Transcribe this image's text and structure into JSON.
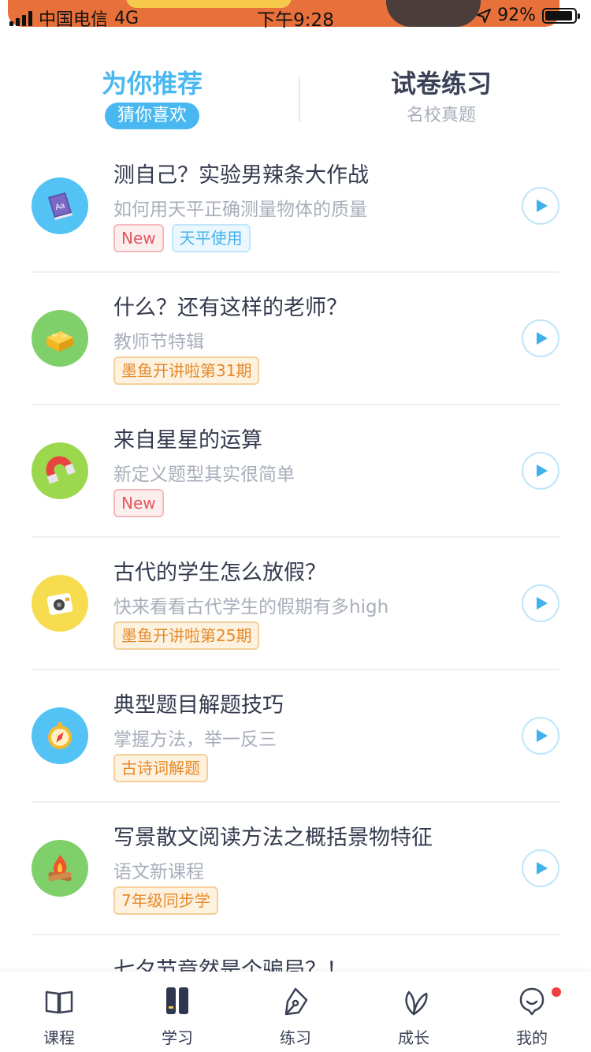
{
  "status_bar": {
    "carrier": "中国电信",
    "network": "4G",
    "time": "下午9:28",
    "battery": "92%"
  },
  "tabs": [
    {
      "title": "为你推荐",
      "subtitle": "猜你喜欢"
    },
    {
      "title": "试卷练习",
      "subtitle": "名校真题"
    }
  ],
  "items": [
    {
      "title": "测自己？实验男辣条大作战",
      "subtitle": "如何用天平正确测量物体的质量",
      "icon": "book-icon",
      "tags": [
        "New",
        "天平使用"
      ]
    },
    {
      "title": "什么？还有这样的老师？",
      "subtitle": "教师节特辑",
      "icon": "block-icon",
      "tags": [
        "墨鱼开讲啦第31期"
      ]
    },
    {
      "title": "来自星星的运算",
      "subtitle": "新定义题型其实很简单",
      "icon": "magnet-icon",
      "tags": [
        "New"
      ]
    },
    {
      "title": "古代的学生怎么放假？",
      "subtitle": "快来看看古代学生的假期有多high",
      "icon": "camera-icon",
      "tags": [
        "墨鱼开讲啦第25期"
      ]
    },
    {
      "title": "典型题目解题技巧",
      "subtitle": "掌握方法，举一反三",
      "icon": "compass-icon",
      "tags": [
        "古诗词解题"
      ]
    },
    {
      "title": "写景散文阅读方法之概括景物特征",
      "subtitle": "语文新课程",
      "icon": "campfire-icon",
      "tags": [
        "7年级同步学"
      ]
    },
    {
      "title": "七夕节竟然是个骗局？！"
    }
  ],
  "nav": [
    {
      "label": "课程",
      "icon": "open-book-icon"
    },
    {
      "label": "学习",
      "icon": "study-books-icon"
    },
    {
      "label": "练习",
      "icon": "pen-icon"
    },
    {
      "label": "成长",
      "icon": "leaf-icon"
    },
    {
      "label": "我的",
      "icon": "profile-icon"
    }
  ],
  "colors": {
    "accent": "#4ab8f0",
    "text": "#333a4d",
    "muted": "#a8aebb",
    "tag_red": "#e0585f",
    "tag_blue": "#44b3ea",
    "tag_orange": "#e58a2a",
    "badge": "#f03d3d"
  }
}
